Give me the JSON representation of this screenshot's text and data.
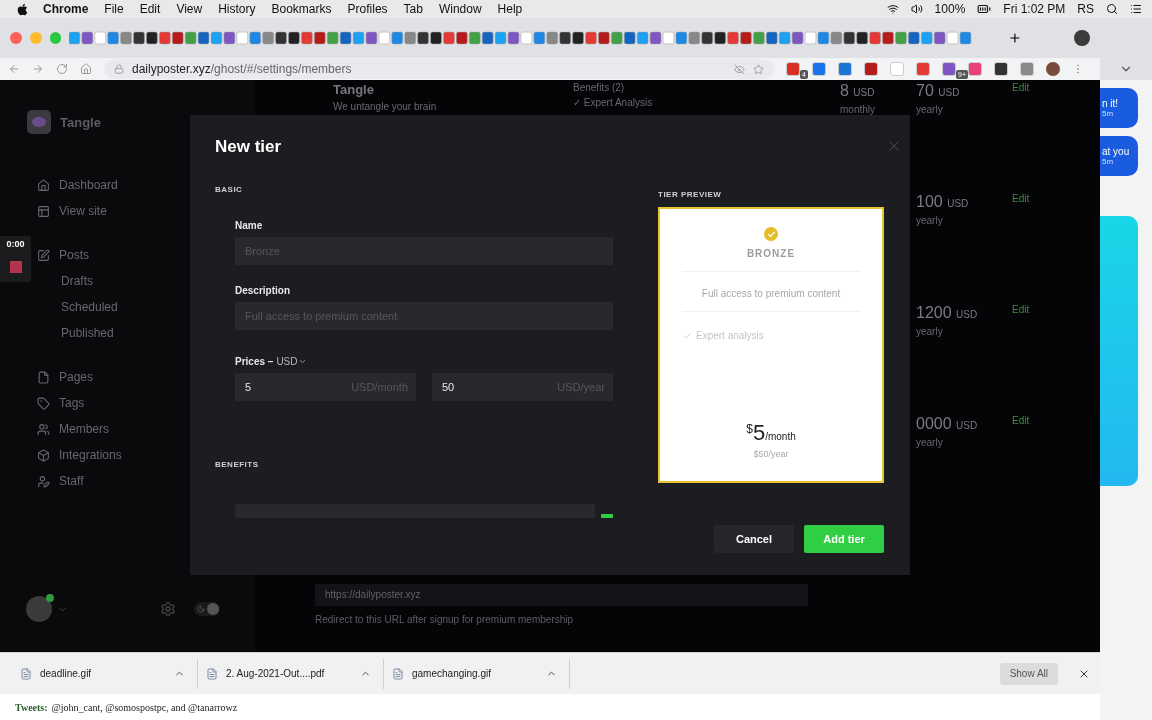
{
  "menu_bar": {
    "app": "Chrome",
    "items": [
      "File",
      "Edit",
      "View",
      "History",
      "Bookmarks",
      "Profiles",
      "Tab",
      "Window",
      "Help"
    ],
    "battery": "100%",
    "clock": "Fri 1:02 PM",
    "user": "RS"
  },
  "browser": {
    "url_domain": "dailyposter.xyz",
    "url_path": "/ghost/#/settings/members",
    "extensions": [
      {
        "color": "#d93025",
        "badge": "4"
      },
      {
        "color": "#1a73e8"
      },
      {
        "color": "#1976d2"
      },
      {
        "color": "#b71c1c"
      },
      {
        "color": "#ffffff"
      },
      {
        "color": "#e53935"
      },
      {
        "color": "#7e57c2",
        "badge": "9+"
      },
      {
        "color": "#ec407a"
      },
      {
        "color": "#333333"
      },
      {
        "color": "#8a8a8a"
      }
    ]
  },
  "recorder": {
    "time": "0:00"
  },
  "dark_mode": {
    "on": true
  },
  "sidebar": {
    "site_name": "Tangle",
    "groups": [
      [
        {
          "label": "Dashboard"
        },
        {
          "label": "View site"
        }
      ],
      [
        {
          "label": "Posts",
          "children": [
            {
              "label": "Drafts"
            },
            {
              "label": "Scheduled"
            },
            {
              "label": "Published"
            }
          ]
        }
      ],
      [
        {
          "label": "Pages"
        },
        {
          "label": "Tags"
        },
        {
          "label": "Members"
        },
        {
          "label": "Integrations"
        },
        {
          "label": "Staff"
        }
      ]
    ]
  },
  "background": {
    "tier_name": "Tangle",
    "tier_description": "We untangle your brain",
    "benefits_heading": "Benefits (2)",
    "benefit": "✓ Expert Analysis",
    "rows": [
      {
        "prices": [
          {
            "amount": "8",
            "currency": "USD",
            "period": "monthly"
          },
          {
            "amount": "70",
            "currency": "USD",
            "period": "yearly"
          }
        ],
        "action": "Edit"
      },
      {
        "prices": [
          {
            "amount": "100",
            "currency": "USD",
            "period": "yearly"
          }
        ],
        "action": "Edit"
      },
      {
        "prices": [
          {
            "amount": "1200",
            "currency": "USD",
            "period": "yearly"
          }
        ],
        "action": "Edit"
      },
      {
        "prices": [
          {
            "amount": "0000",
            "currency": "USD",
            "period": "yearly"
          }
        ],
        "action": "Edit"
      }
    ],
    "redirect_placeholder": "https://dailyposter.xyz",
    "redirect_hint": "Redirect to this URL after signup for premium membership"
  },
  "modal": {
    "title": "New tier",
    "basic_heading": "BASIC",
    "name_label": "Name",
    "name_placeholder": "Bronze",
    "description_label": "Description",
    "description_placeholder": "Full access to premium content",
    "prices_label": "Prices –",
    "currency": "USD",
    "prices": [
      {
        "value": "5",
        "unit": "USD/month"
      },
      {
        "value": "50",
        "unit": "USD/year"
      }
    ],
    "benefits_heading": "BENEFITS",
    "preview": {
      "heading": "TIER PREVIEW",
      "name": "BRONZE",
      "description": "Full access to premium content",
      "benefits": [
        "Expert analysis"
      ],
      "currency_symbol": "$",
      "amount": "5",
      "period": "/month",
      "yearly": "$50/year"
    },
    "buttons": {
      "cancel": "Cancel",
      "submit": "Add tier"
    }
  },
  "downloads": {
    "files": [
      {
        "name": "deadline.gif"
      },
      {
        "name": "2. Aug-2021-Out....pdf"
      },
      {
        "name": "gamechanging.gif"
      }
    ],
    "show_all": "Show All"
  },
  "behind_page": {
    "tweets_label": "Tweets:",
    "tweets_text": "@john_cant, @somospostpc, and @tanarrowz"
  },
  "side_window": {
    "messages": [
      {
        "text": "n it!",
        "time": "5m"
      },
      {
        "text": "at you",
        "time": "5m"
      }
    ]
  }
}
